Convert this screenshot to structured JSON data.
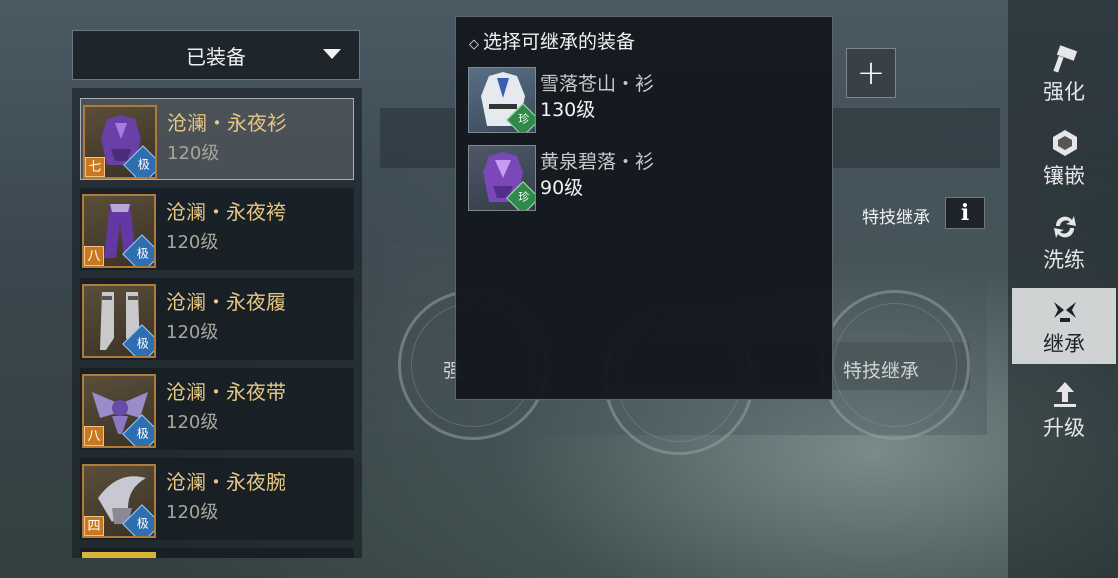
{
  "dropdown": {
    "label": "已装备"
  },
  "equipped_items": [
    {
      "name": "沧澜・永夜衫",
      "level": "120级",
      "rank": "七",
      "grade": "极",
      "selected": true
    },
    {
      "name": "沧澜・永夜袴",
      "level": "120级",
      "rank": "八",
      "grade": "极",
      "selected": false
    },
    {
      "name": "沧澜・永夜履",
      "level": "120级",
      "rank": "",
      "grade": "极",
      "selected": false
    },
    {
      "name": "沧澜・永夜带",
      "level": "120级",
      "rank": "八",
      "grade": "极",
      "selected": false
    },
    {
      "name": "沧澜・永夜腕",
      "level": "120级",
      "rank": "四",
      "grade": "极",
      "selected": false
    }
  ],
  "popup": {
    "title": "选择可继承的装备",
    "items": [
      {
        "name": "雪落苍山・衫",
        "level": "130级",
        "badge": "珍"
      },
      {
        "name": "黄泉碧落・衫",
        "level": "90级",
        "badge": "珍"
      }
    ]
  },
  "inherit": {
    "label": "特技继承",
    "info_icon": "i"
  },
  "circles": {
    "left_label_fragment": "强",
    "right_label": "特技继承"
  },
  "nav": [
    {
      "label": "强化",
      "icon": "hammer-icon",
      "active": false
    },
    {
      "label": "镶嵌",
      "icon": "gem-icon",
      "active": false
    },
    {
      "label": "洗练",
      "icon": "refresh-icon",
      "active": false
    },
    {
      "label": "继承",
      "icon": "inherit-icon",
      "active": true
    },
    {
      "label": "升级",
      "icon": "upgrade-icon",
      "active": false
    }
  ],
  "colors": {
    "item_name": "#e7c782",
    "rank_badge": "#c9781f",
    "grade_badge": "#2f6fb0",
    "rare_badge": "#2f8a4a"
  }
}
